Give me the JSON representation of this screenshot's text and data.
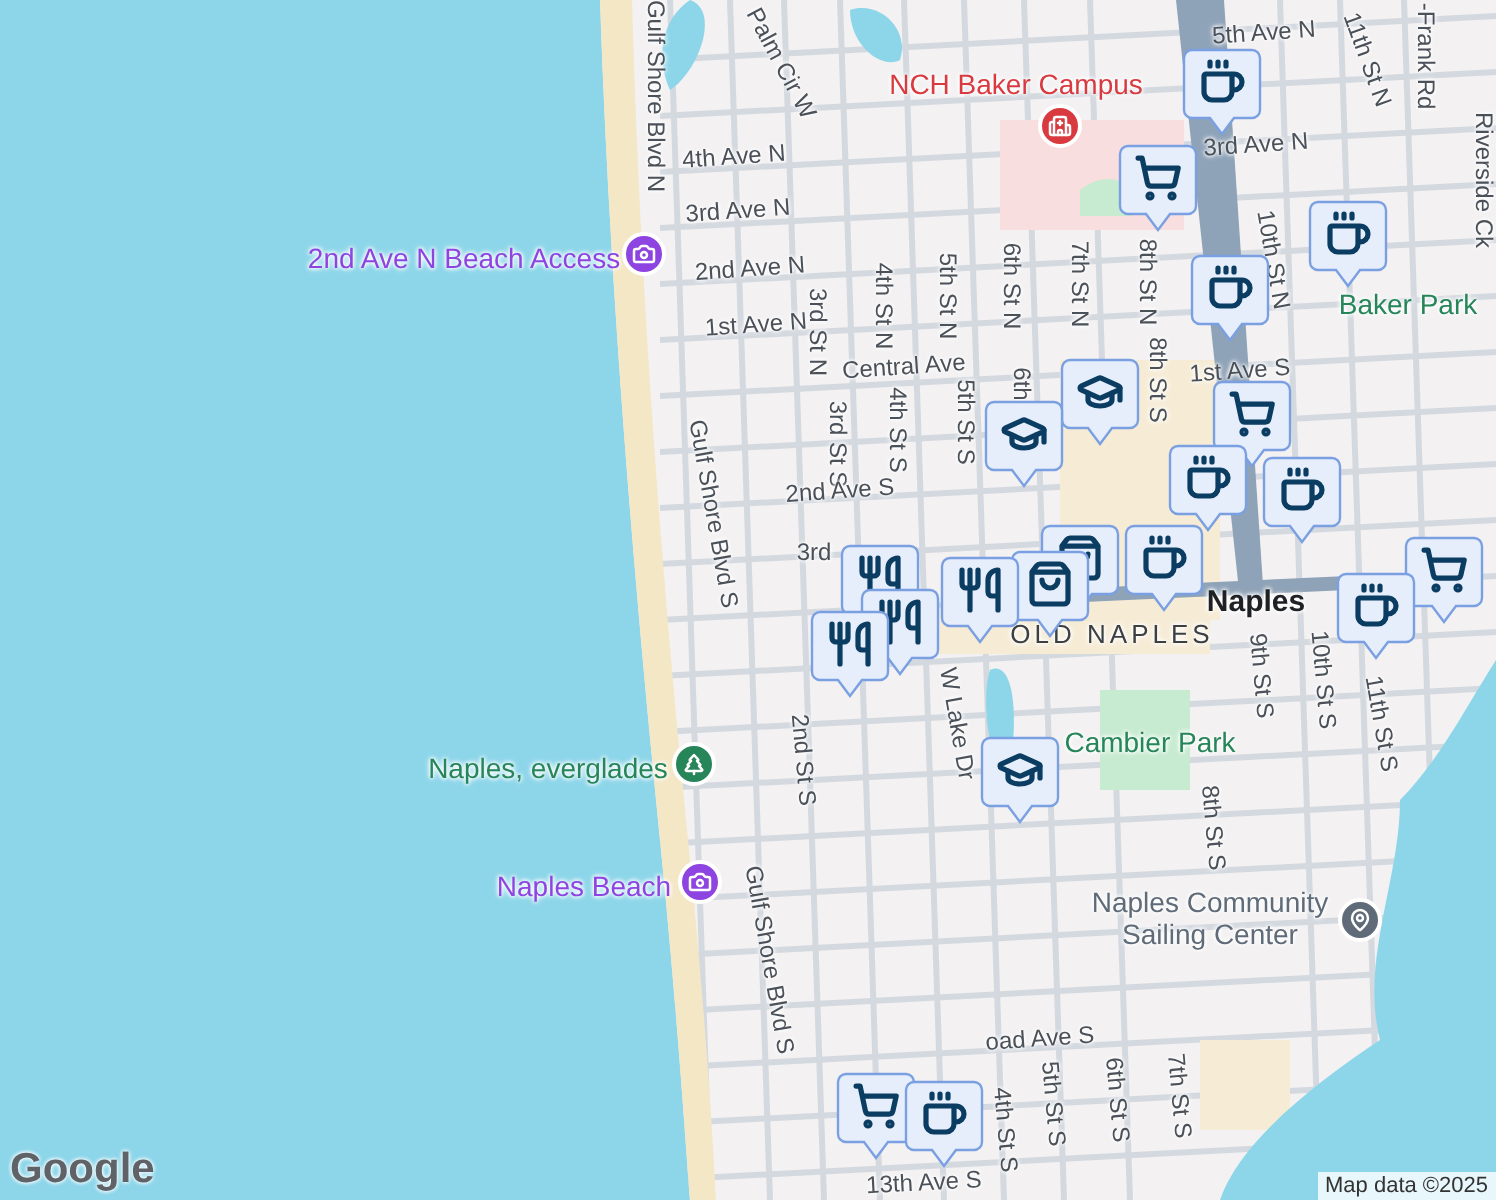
{
  "map": {
    "streets": [
      {
        "text": "Gulf Shore Blvd N"
      },
      {
        "text": "Palm Cir W"
      },
      {
        "text": "5th Ave N"
      },
      {
        "text": "4th Ave N"
      },
      {
        "text": "3rd Ave N"
      },
      {
        "text": "2nd Ave N"
      },
      {
        "text": "1st Ave N"
      },
      {
        "text": "3rd St N"
      },
      {
        "text": "4th St N"
      },
      {
        "text": "5th St N"
      },
      {
        "text": "6th St N"
      },
      {
        "text": "7th St N"
      },
      {
        "text": "8th St N"
      },
      {
        "text": "3rd Ave N"
      },
      {
        "text": "11th St N"
      },
      {
        "text": "-Frank Rd"
      },
      {
        "text": "10th St N"
      },
      {
        "text": "Riverside Ck"
      },
      {
        "text": "Central Ave"
      },
      {
        "text": "1st Ave S"
      },
      {
        "text": "3rd St S"
      },
      {
        "text": "4th St S"
      },
      {
        "text": "5th St S"
      },
      {
        "text": "6th"
      },
      {
        "text": "8th St S"
      },
      {
        "text": "Gulf Shore Blvd S"
      },
      {
        "text": "2nd Ave S"
      },
      {
        "text": "3rd"
      },
      {
        "text": "9th St S"
      },
      {
        "text": "10th St S"
      },
      {
        "text": "11th St S"
      },
      {
        "text": "2nd St S"
      },
      {
        "text": "W Lake Dr"
      },
      {
        "text": "8th St S"
      },
      {
        "text": "Gulf Shore Blvd S"
      },
      {
        "text": "oad Ave S"
      },
      {
        "text": "4th St S"
      },
      {
        "text": "5th St S"
      },
      {
        "text": "6th St S"
      },
      {
        "text": "7th St S"
      },
      {
        "text": "13th Ave S"
      }
    ],
    "areas": [
      {
        "text": "Naples",
        "kind": "city"
      },
      {
        "text": "OLD NAPLES",
        "kind": "district"
      }
    ],
    "places": [
      {
        "text": "NCH Baker Campus",
        "kind": "hospital",
        "color": "#d93a40"
      },
      {
        "text": "2nd Ave N Beach Access",
        "kind": "photo",
        "color": "#8e44e0"
      },
      {
        "text": "Baker Park",
        "kind": "label",
        "color": "#27855a"
      },
      {
        "text": "Cambier Park",
        "kind": "label",
        "color": "#27855a"
      },
      {
        "text": "Naples, everglades",
        "kind": "park",
        "color": "#27855a"
      },
      {
        "text": "Naples Beach",
        "kind": "photo",
        "color": "#8e44e0"
      },
      {
        "text": "Naples Community Sailing Center",
        "kind": "pin",
        "color": "#5f6b78"
      }
    ],
    "markers": [
      {
        "kind": "coffee"
      },
      {
        "kind": "cart"
      },
      {
        "kind": "coffee"
      },
      {
        "kind": "coffee"
      },
      {
        "kind": "school"
      },
      {
        "kind": "school"
      },
      {
        "kind": "cart"
      },
      {
        "kind": "coffee"
      },
      {
        "kind": "coffee"
      },
      {
        "kind": "shopping"
      },
      {
        "kind": "dining"
      },
      {
        "kind": "coffee"
      },
      {
        "kind": "shopping"
      },
      {
        "kind": "dining"
      },
      {
        "kind": "dining"
      },
      {
        "kind": "dining"
      },
      {
        "kind": "cart"
      },
      {
        "kind": "coffee"
      },
      {
        "kind": "school"
      },
      {
        "kind": "cart"
      },
      {
        "kind": "coffee"
      }
    ],
    "logo": "Google",
    "attribution": "Map data ©2025"
  }
}
